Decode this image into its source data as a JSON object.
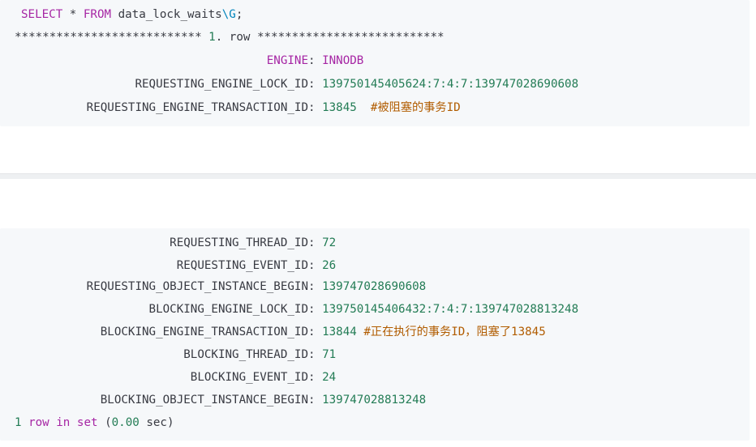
{
  "block1": {
    "query": {
      "select": "SELECT",
      "star": " * ",
      "from": "FROM",
      "table": " data_lock_waits",
      "escape": "\\G",
      "semicolon": ";"
    },
    "row_header": {
      "stars_left": "*************************** ",
      "row_num": "1",
      "row_word": ". row",
      "stars_right": " ***************************"
    },
    "rows": [
      {
        "field": "ENGINE",
        "value": "INNODB",
        "comment": ""
      },
      {
        "field": "REQUESTING_ENGINE_LOCK_ID",
        "value": "139750145405624:7:4:7:139747028690608",
        "comment": ""
      },
      {
        "field": "REQUESTING_ENGINE_TRANSACTION_ID",
        "value": "13845",
        "comment": "#被阻塞的事务ID"
      }
    ]
  },
  "block2": {
    "rows": [
      {
        "field": "REQUESTING_THREAD_ID",
        "value": "72",
        "comment": ""
      },
      {
        "field": "REQUESTING_EVENT_ID",
        "value": "26",
        "comment": ""
      },
      {
        "field": "REQUESTING_OBJECT_INSTANCE_BEGIN",
        "value": "139747028690608",
        "comment": ""
      },
      {
        "field": "BLOCKING_ENGINE_LOCK_ID",
        "value": "139750145406432:7:4:7:139747028813248",
        "comment": ""
      },
      {
        "field": "BLOCKING_ENGINE_TRANSACTION_ID",
        "value": "13844",
        "comment": "#正在执行的事务ID，阻塞了13845"
      },
      {
        "field": "BLOCKING_THREAD_ID",
        "value": "71",
        "comment": ""
      },
      {
        "field": "BLOCKING_EVENT_ID",
        "value": "24",
        "comment": ""
      },
      {
        "field": "BLOCKING_OBJECT_INSTANCE_BEGIN",
        "value": "139747028813248",
        "comment": ""
      }
    ],
    "footer": {
      "count": "1",
      "row_word": " row ",
      "in": "in",
      "set": " set",
      "open": " (",
      "time": "0.00",
      "unit": " sec)"
    }
  },
  "colors": {
    "keyword": "#a626a4",
    "number": "#237c55",
    "comment": "#b15c00",
    "escape": "#0184bc",
    "background": "#f6f8fa"
  }
}
